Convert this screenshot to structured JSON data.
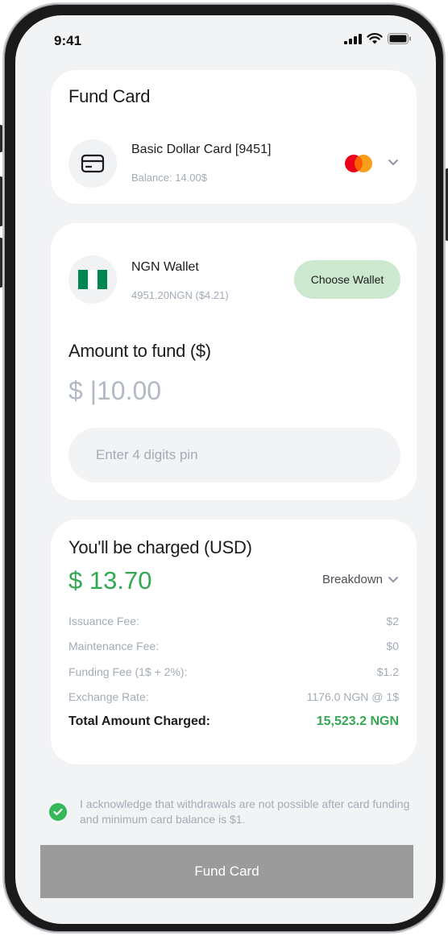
{
  "status_bar": {
    "time": "9:41"
  },
  "fund_card": {
    "title": "Fund Card",
    "card_name": "Basic Dollar Card [9451]",
    "balance": "Balance: 14.00$",
    "card_icon": "credit-card-icon",
    "network_icon": "mastercard-icon"
  },
  "wallet": {
    "name": "NGN Wallet",
    "balance": "4951.20NGN ($4.21)",
    "flag_icon": "nigeria-flag-icon",
    "choose_label": "Choose Wallet",
    "amount_label": "Amount to fund ($)",
    "amount_value": "$ |10.00",
    "pin_placeholder": "Enter 4 digits pin"
  },
  "summary": {
    "heading": "You'll be charged (USD)",
    "amount": "$ 13.70",
    "breakdown_label": "Breakdown",
    "fees": [
      {
        "label": "Issuance Fee:",
        "value": "$2"
      },
      {
        "label": "Maintenance Fee:",
        "value": "$0"
      },
      {
        "label": "Funding Fee (1$ + 2%):",
        "value": "$1.2"
      },
      {
        "label": "Exchange Rate:",
        "value": "1176.0 NGN @ 1$"
      }
    ],
    "total_label": "Total Amount Charged:",
    "total_value": "15,523.2 NGN"
  },
  "acknowledgement": {
    "text": "I acknowledge that withdrawals are not possible after card funding and minimum card balance is $1.",
    "checked": true
  },
  "fund_button": {
    "label": "Fund Card"
  },
  "colors": {
    "accent_green": "#33a853",
    "button_green_light": "#cce8cf",
    "fund_button_gray": "#9b9b9b",
    "background": "#f2f3f5"
  }
}
